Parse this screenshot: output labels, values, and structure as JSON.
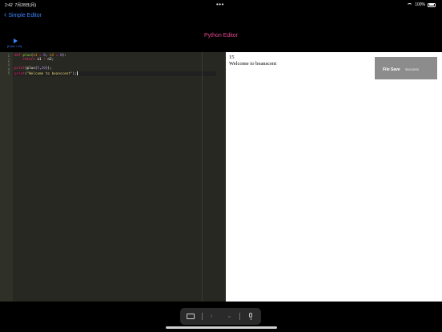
{
  "status": {
    "time": "2:42",
    "date": "7月28日(月)",
    "battery": "100%"
  },
  "nav": {
    "back_label": "Simple Editor",
    "title": "Python Editor"
  },
  "run": {
    "hint": "(Cmd + R)"
  },
  "editor": {
    "line_numbers": [
      "1",
      "2",
      "3",
      "4",
      "5"
    ],
    "lines": [
      [
        {
          "t": "def ",
          "c": "kw"
        },
        {
          "t": "plus",
          "c": "fn"
        },
        {
          "t": "(",
          "c": "plain"
        },
        {
          "t": "n1",
          "c": "arg"
        },
        {
          "t": " = ",
          "c": "kw"
        },
        {
          "t": "0",
          "c": "num"
        },
        {
          "t": ", ",
          "c": "plain"
        },
        {
          "t": "n2",
          "c": "arg"
        },
        {
          "t": " = ",
          "c": "kw"
        },
        {
          "t": "0",
          "c": "num"
        },
        {
          "t": "):",
          "c": "plain"
        }
      ],
      [
        {
          "t": "    return ",
          "c": "kw"
        },
        {
          "t": "n1 ",
          "c": "plain"
        },
        {
          "t": "+",
          "c": "kw"
        },
        {
          "t": " n2;",
          "c": "plain"
        }
      ],
      [
        {
          "t": "",
          "c": "plain"
        }
      ],
      [
        {
          "t": "print",
          "c": "kw"
        },
        {
          "t": "(plus(",
          "c": "plain"
        },
        {
          "t": "5",
          "c": "num"
        },
        {
          "t": ",",
          "c": "plain"
        },
        {
          "t": "10",
          "c": "num"
        },
        {
          "t": "));",
          "c": "plain"
        }
      ],
      [
        {
          "t": "print",
          "c": "kw"
        },
        {
          "t": "(",
          "c": "plain"
        },
        {
          "t": "\"Welcome to beanscent\"",
          "c": "str"
        },
        {
          "t": ");",
          "c": "plain"
        }
      ]
    ]
  },
  "output": {
    "lines": [
      "15",
      "Welcome to beanscent"
    ]
  },
  "toast": {
    "title": "File Save",
    "message": "Success"
  },
  "colors": {
    "accent": "#3a86ff",
    "title": "#e5488f",
    "editor_bg": "#272822",
    "toast_bg": "#8c8c8c"
  }
}
